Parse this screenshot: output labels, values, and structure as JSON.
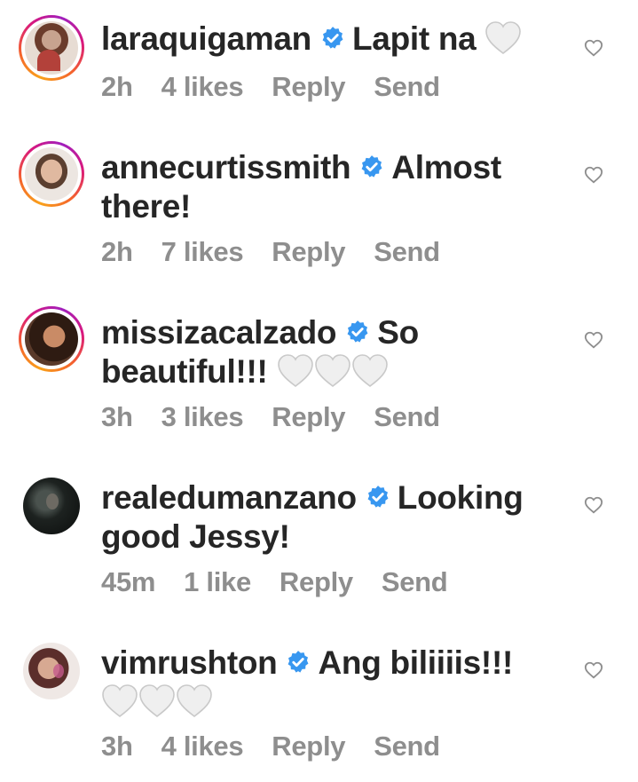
{
  "comments": [
    {
      "username": "laraquigaman",
      "text": "Lapit na",
      "emoji_hearts": 1,
      "time": "2h",
      "likes": "4 likes",
      "reply": "Reply",
      "send": "Send",
      "avatar_colors": [
        "#d3c2b4",
        "#b8877a"
      ]
    },
    {
      "username": "annecurtissmith",
      "text": "Almost there!",
      "emoji_hearts": 0,
      "time": "2h",
      "likes": "7 likes",
      "reply": "Reply",
      "send": "Send",
      "avatar_colors": [
        "#e9e3de",
        "#8a6b5a"
      ]
    },
    {
      "username": "missizacalzado",
      "text": "So beautiful!!!",
      "emoji_hearts": 3,
      "time": "3h",
      "likes": "3 likes",
      "reply": "Reply",
      "send": "Send",
      "avatar_colors": [
        "#a06a4d",
        "#3b2419"
      ]
    },
    {
      "username": "realedumanzano",
      "text": "Looking good Jessy!",
      "emoji_hearts": 0,
      "time": "45m",
      "likes": "1 like",
      "reply": "Reply",
      "send": "Send",
      "avatar_colors": [
        "#2a2f2c",
        "#111513"
      ]
    },
    {
      "username": "vimrushton",
      "text": "Ang biliiiis!!!",
      "emoji_hearts": 3,
      "time": "3h",
      "likes": "4 likes",
      "reply": "Reply",
      "send": "Send",
      "avatar_colors": [
        "#e6e0de",
        "#6b3a38"
      ]
    }
  ],
  "colors": {
    "text": "#262626",
    "meta": "#8e8e8e",
    "verified": "#3897f0",
    "heart_emoji": "#e8e8e8"
  },
  "icons": {
    "verified": "verified-badge-icon",
    "emoji": "white-heart-emoji-icon",
    "like": "heart-outline-icon"
  }
}
